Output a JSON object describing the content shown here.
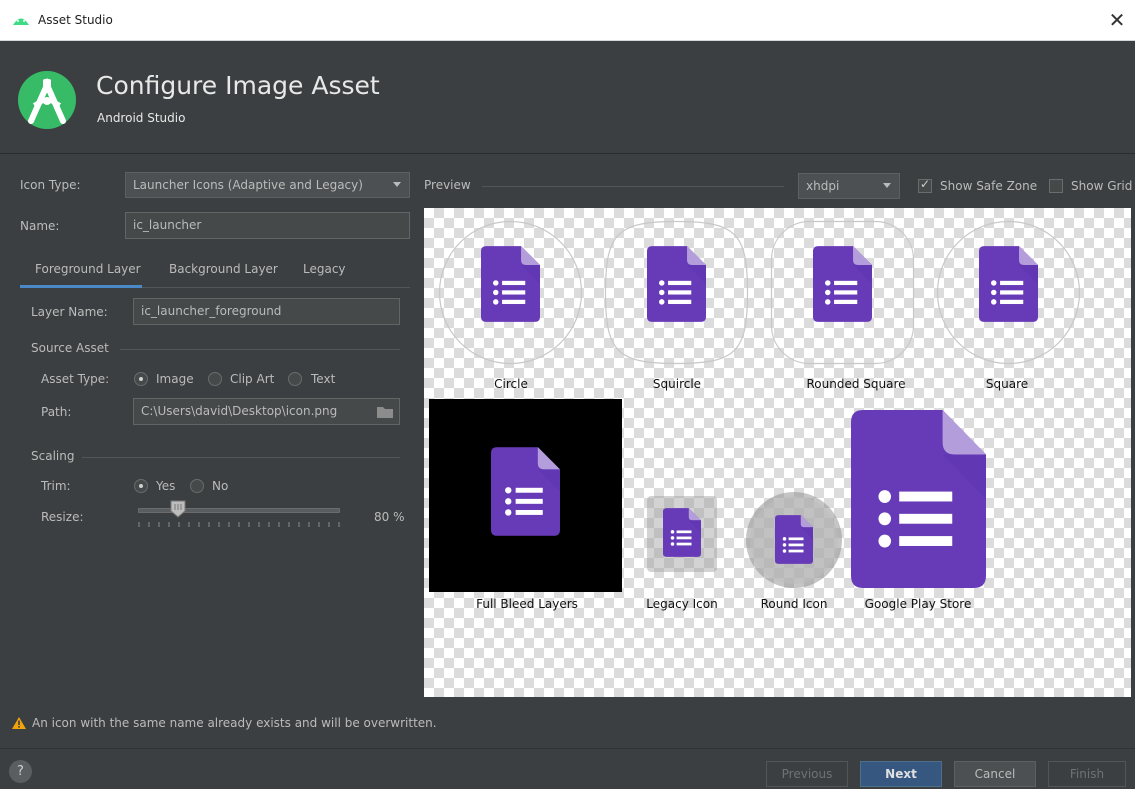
{
  "window": {
    "title": "Asset Studio",
    "close_glyph": "✕"
  },
  "header": {
    "title": "Configure Image Asset",
    "subtitle": "Android Studio"
  },
  "form": {
    "icon_type_label": "Icon Type:",
    "icon_type_value": "Launcher Icons (Adaptive and Legacy)",
    "name_label": "Name:",
    "name_value": "ic_launcher"
  },
  "tabs": [
    {
      "label": "Foreground Layer",
      "active": true
    },
    {
      "label": "Background Layer",
      "active": false
    },
    {
      "label": "Legacy",
      "active": false
    }
  ],
  "layer": {
    "layer_name_label": "Layer Name:",
    "layer_name_value": "ic_launcher_foreground",
    "source_asset_label": "Source Asset",
    "asset_type_label": "Asset Type:",
    "asset_type_options": [
      "Image",
      "Clip Art",
      "Text"
    ],
    "asset_type_selected": "Image",
    "path_label": "Path:",
    "path_value": "C:\\Users\\david\\Desktop\\icon.png",
    "scaling_label": "Scaling",
    "trim_label": "Trim:",
    "trim_options": [
      "Yes",
      "No"
    ],
    "trim_selected": "Yes",
    "resize_label": "Resize:",
    "resize_value": 80,
    "resize_text": "80 %"
  },
  "preview": {
    "label": "Preview",
    "density": "xhdpi",
    "show_safe_zone_label": "Show Safe Zone",
    "show_safe_zone": true,
    "show_grid_label": "Show Grid",
    "show_grid": false,
    "captions": {
      "circle": "Circle",
      "squircle": "Squircle",
      "rounded_square": "Rounded Square",
      "square": "Square",
      "full_bleed": "Full Bleed Layers",
      "legacy": "Legacy Icon",
      "round": "Round Icon",
      "play_store": "Google Play Store"
    }
  },
  "warning": "An icon with the same name already exists and will be overwritten.",
  "footer": {
    "help": "?",
    "previous": "Previous",
    "next": "Next",
    "cancel": "Cancel",
    "finish": "Finish"
  },
  "colors": {
    "icon_purple": "#673ab7",
    "icon_fold": "#b39ddb",
    "accent_blue": "#4a88c7",
    "warning_yellow": "#f0a30a"
  },
  "icons": [
    "android-studio-logo",
    "google-forms-icon",
    "folder-icon",
    "warning-icon",
    "help-icon"
  ]
}
